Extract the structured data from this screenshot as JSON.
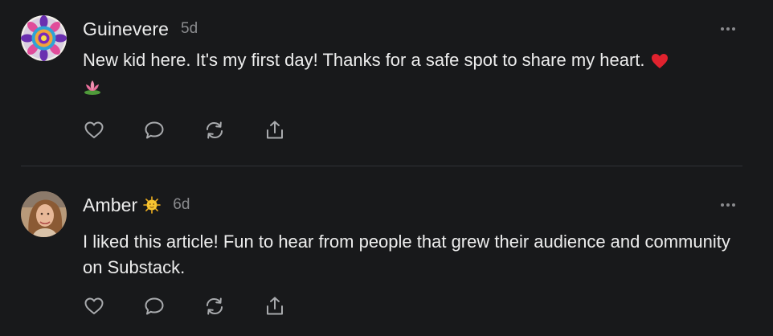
{
  "comments": [
    {
      "author": "Guinevere",
      "time": "5d",
      "text": "New kid here. It's my first day! Thanks for a safe spot to share my heart. ",
      "emojis": [
        "red-heart",
        "lotus"
      ],
      "avatar": "mandala-avatar"
    },
    {
      "author": "Amber",
      "time": "6d",
      "text": "I liked this article! Fun to hear from people that grew their audience and community on Substack.",
      "badge": "sun-emoji",
      "avatar": "photo-avatar"
    }
  ],
  "actions": [
    "heart-icon",
    "comment-icon",
    "restack-icon",
    "share-icon"
  ],
  "colors": {
    "background": "#18191b",
    "text": "#ededed",
    "muted": "#8a8b8e",
    "icon": "#a9abae",
    "divider": "#303236"
  }
}
